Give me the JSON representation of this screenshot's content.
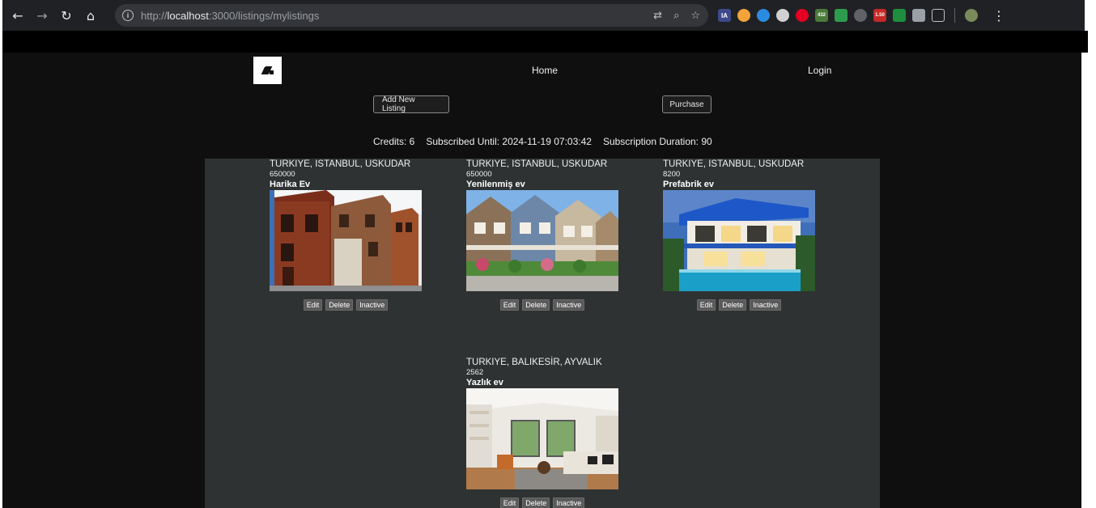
{
  "browser": {
    "url_prefix": "http://",
    "url_host": "localhost",
    "url_rest": ":3000/listings/mylistings",
    "ext_badge_1": "432",
    "ext_badge_2": "1.50"
  },
  "nav": {
    "home": "Home",
    "login": "Login"
  },
  "actions": {
    "add_listing": "Add New Listing",
    "purchase": "Purchase"
  },
  "stats": {
    "credits": "Credits: 6",
    "subscribed_until": "Subscribed Until: 2024-11-19 07:03:42",
    "subscription_duration": "Subscription Duration: 90"
  },
  "listings": [
    {
      "location": "TURKIYE, ISTANBUL, USKUDAR",
      "price": "650000",
      "title": "Harika Ev",
      "image": "wooden-townhouses-photo"
    },
    {
      "location": "TURKIYE, ISTANBUL, USKUDAR",
      "price": "650000",
      "title": "Yenilenmiş ev",
      "image": "suburban-row-houses-photo"
    },
    {
      "location": "TURKIYE, ISTANBUL, USKUDAR",
      "price": "8200",
      "title": "Prefabrik ev",
      "image": "modern-villa-pool-photo"
    },
    {
      "location": "TURKIYE, BALIKESİR, AYVALIK",
      "price": "2562",
      "title": "Yazlık ev",
      "image": "living-room-interior-photo"
    }
  ],
  "card_buttons": {
    "edit": "Edit",
    "delete": "Delete",
    "inactive": "Inactive"
  },
  "colors": {
    "page_bg": "#0f0f0f",
    "panel_bg": "#2e3232",
    "chrome_bg": "#202124"
  }
}
